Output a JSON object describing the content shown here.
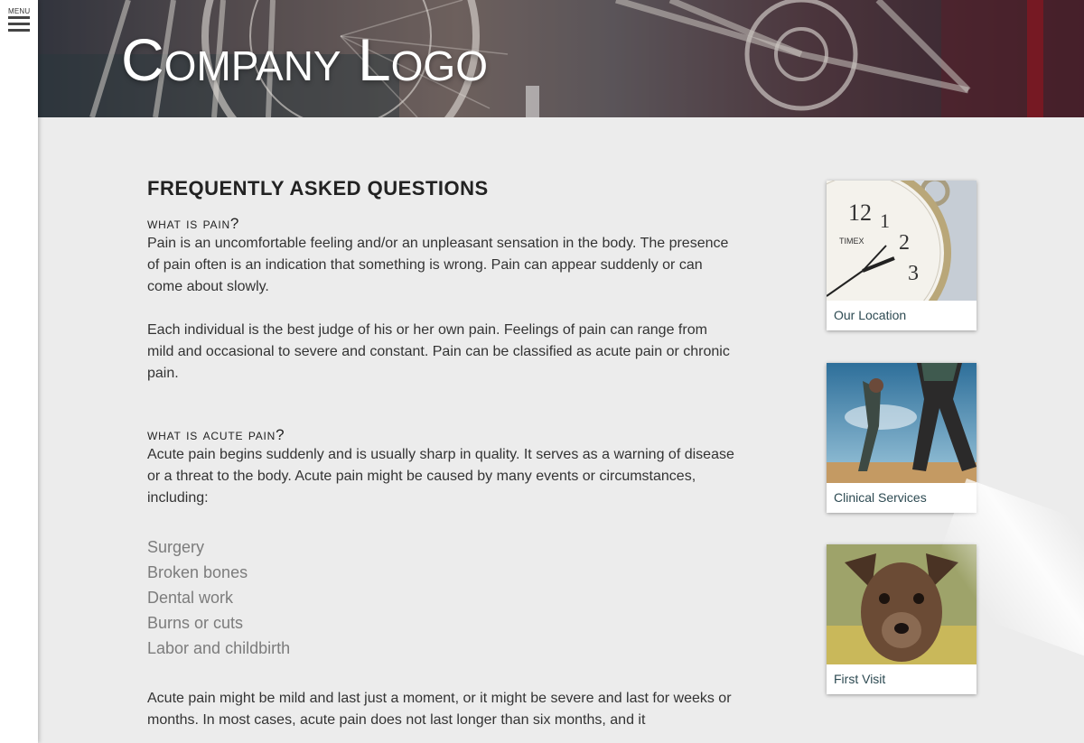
{
  "menu": {
    "label": "MENU",
    "icon": "hamburger-icon"
  },
  "header": {
    "logo_text": "Company Logo"
  },
  "faq": {
    "title": "FREQUENTLY ASKED QUESTIONS",
    "sections": [
      {
        "heading": "WHAT IS PAIN?",
        "paragraphs": [
          "Pain is an uncomfortable feeling and/or an unpleasant sensation in the body. The presence of pain often is an indication that something is wrong. Pain can appear suddenly or can come about slowly.",
          "Each individual is the best judge of his or her own pain. Feelings of pain can range from mild and occasional to severe and constant. Pain can be classified as acute pain or chronic pain."
        ]
      },
      {
        "heading": "WHAT IS ACUTE PAIN?",
        "paragraphs": [
          "Acute pain begins suddenly and is usually sharp in quality. It serves as a warning of disease or a threat to the body. Acute pain might be caused by many events or circumstances, including:"
        ],
        "list": [
          "Surgery",
          "Broken bones",
          "Dental work",
          "Burns or cuts",
          "Labor and childbirth"
        ],
        "after_list": "Acute pain might be mild and last just a moment, or it might be severe and last for weeks or months. In most cases, acute pain does not last longer than six months, and it"
      }
    ]
  },
  "sidebar": {
    "cards": [
      {
        "label": "Our Location",
        "image": "alarm-clock-photo",
        "clock_brand": "TIMEX"
      },
      {
        "label": "Clinical Services",
        "image": "athletes-photo"
      },
      {
        "label": "First Visit",
        "image": "puppy-photo"
      }
    ]
  },
  "colors": {
    "background": "#ececec",
    "caption_text": "#2d4a52",
    "list_text": "#7c7c7c"
  }
}
